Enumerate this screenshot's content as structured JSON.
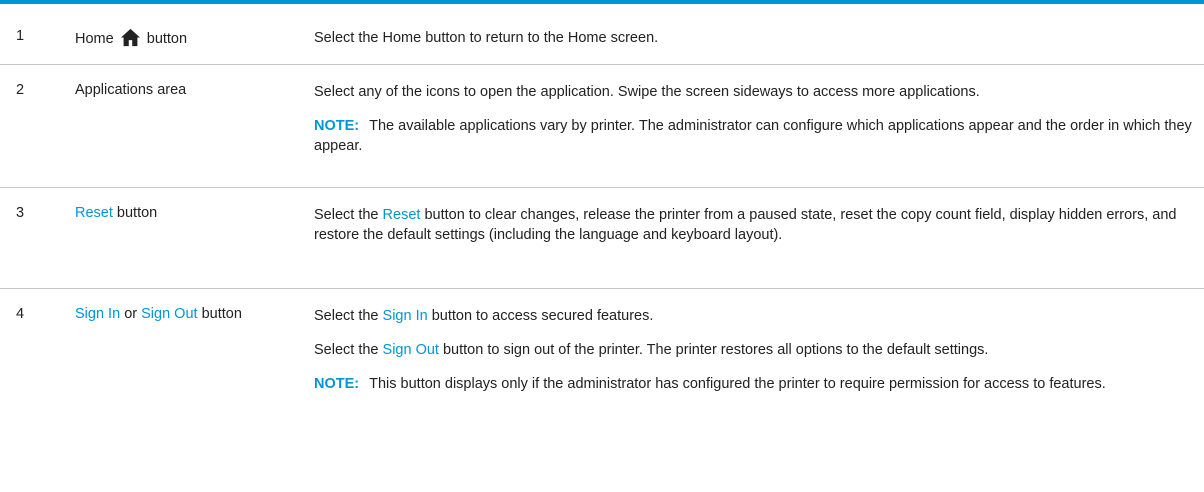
{
  "rows": [
    {
      "num": "1",
      "item_pre": "Home",
      "item_post": "button",
      "desc": "Select the Home button to return to the Home screen."
    },
    {
      "num": "2",
      "item": "Applications area",
      "desc": "Select any of the icons to open the application. Swipe the screen sideways to access more applications.",
      "note_label": "NOTE:",
      "note": "The available applications vary by printer. The administrator can configure which applications appear and the order in which they appear."
    },
    {
      "num": "3",
      "item_link": "Reset",
      "item_post": "button",
      "desc_pre": "Select the",
      "desc_link": "Reset",
      "desc_post": "button to clear changes, release the printer from a paused state, reset the copy count field, display hidden errors, and restore the default settings (including the language and keyboard layout)."
    },
    {
      "num": "4",
      "item_link1": "Sign In",
      "item_mid": "or",
      "item_link2": "Sign Out",
      "item_post": "button",
      "desc1_pre": "Select the",
      "desc1_link": "Sign In",
      "desc1_post": "button to access secured features.",
      "desc2_pre": "Select the",
      "desc2_link": "Sign Out",
      "desc2_post": "button to sign out of the printer. The printer restores all options to the default settings.",
      "note_label": "NOTE:",
      "note": "This button displays only if the administrator has configured the printer to require permission for access to features."
    }
  ],
  "colors": {
    "accent": "#0096d6",
    "rule": "#c8c8c8"
  },
  "icons": {
    "home": "home-icon"
  }
}
